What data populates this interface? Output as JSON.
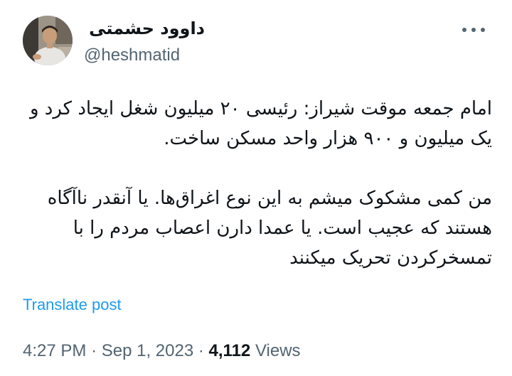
{
  "author": {
    "display_name": "داوود حشمتی",
    "handle": "@heshmatid"
  },
  "tweet": {
    "paragraphs": [
      "امام جمعه موقت شیراز: رئیسی ۲۰ میلیون شغل ایجاد کرد و یک میلیون و ۹۰۰ هزار واحد مسکن ساخت.",
      "من کمی مشکوک میشم به این نوع اغراق‌ها. یا آنقدر ناآگاه هستند که عجیب است. یا عمدا دارن اعصاب مردم را با تمسخرکردن تحریک میکنند"
    ]
  },
  "translate_label": "Translate post",
  "meta": {
    "time": "4:27 PM",
    "separator": "·",
    "date": "Sep 1, 2023",
    "views_count": "4,112",
    "views_label": "Views"
  },
  "icons": {
    "more": "more-horizontal-icon",
    "avatar": "avatar-photo"
  },
  "colors": {
    "text": "#0f1419",
    "secondary": "#536471",
    "link": "#1d9bf0"
  }
}
